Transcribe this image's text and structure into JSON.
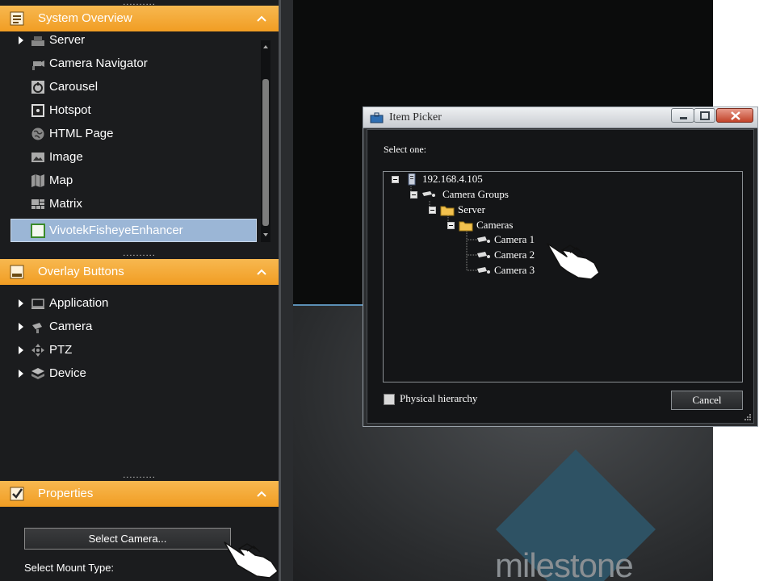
{
  "panels": {
    "system_overview": {
      "title": "System Overview",
      "items": [
        {
          "label": "Server",
          "icon": "server-icon",
          "arrow": true
        },
        {
          "label": "Camera Navigator",
          "icon": "camera-navigator-icon",
          "arrow": false
        },
        {
          "label": "Carousel",
          "icon": "carousel-icon",
          "arrow": false
        },
        {
          "label": "Hotspot",
          "icon": "hotspot-icon",
          "arrow": false
        },
        {
          "label": "HTML Page",
          "icon": "globe-icon",
          "arrow": false
        },
        {
          "label": "Image",
          "icon": "image-icon",
          "arrow": false
        },
        {
          "label": "Map",
          "icon": "map-icon",
          "arrow": false
        },
        {
          "label": "Matrix",
          "icon": "matrix-icon",
          "arrow": false
        },
        {
          "label": "VivotekFisheyeEnhancer",
          "icon": "plugin-icon",
          "arrow": false,
          "selected": true
        }
      ]
    },
    "overlay_buttons": {
      "title": "Overlay Buttons",
      "items": [
        {
          "label": "Application",
          "icon": "monitor-icon"
        },
        {
          "label": "Camera",
          "icon": "camera-icon"
        },
        {
          "label": "PTZ",
          "icon": "ptz-icon"
        },
        {
          "label": "Device",
          "icon": "device-icon"
        }
      ]
    },
    "properties": {
      "title": "Properties",
      "select_camera_label": "Select Camera...",
      "mount_type_label": "Select Mount Type:"
    }
  },
  "divider_dots": "..........",
  "logo_text": "milestone",
  "dialog": {
    "title": "Item Picker",
    "prompt": "Select one:",
    "tree": [
      {
        "label": "192.168.4.105",
        "icon": "server-tower-icon",
        "level": 0,
        "expanded": true
      },
      {
        "label": "Camera Groups",
        "icon": "camera-group-icon",
        "level": 1,
        "expanded": true
      },
      {
        "label": "Server",
        "icon": "folder-icon",
        "level": 2,
        "expanded": true
      },
      {
        "label": "Cameras",
        "icon": "folder-icon",
        "level": 3,
        "expanded": true
      },
      {
        "label": "Camera 1",
        "icon": "camera-icon",
        "level": 4
      },
      {
        "label": "Camera 2",
        "icon": "camera-icon",
        "level": 4
      },
      {
        "label": "Camera 3",
        "icon": "camera-icon",
        "level": 4
      }
    ],
    "physical_hierarchy_label": "Physical hierarchy",
    "physical_hierarchy_checked": false,
    "cancel_label": "Cancel"
  },
  "colors": {
    "header_orange": "#f19d23",
    "selection_blue": "#9bb6d6",
    "panel_bg": "#1b1c1e",
    "logo_teal": "#2e5264"
  }
}
